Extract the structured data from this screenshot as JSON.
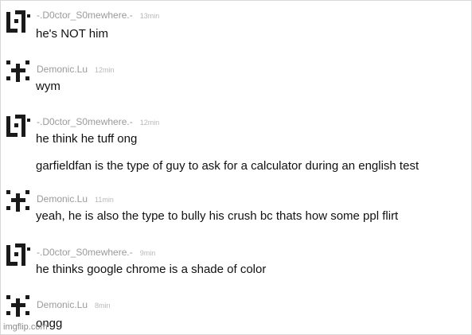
{
  "messages": [
    {
      "user": "-.D0ctor_S0mewhere.-",
      "time": "13min",
      "avatar_icon": "qr-pattern-icon",
      "lines": [
        "he's NOT him"
      ]
    },
    {
      "user": "Demonic.Lu",
      "time": "12min",
      "avatar_icon": "cross-pattern-icon",
      "lines": [
        "wym"
      ]
    },
    {
      "user": "-.D0ctor_S0mewhere.-",
      "time": "12min",
      "avatar_icon": "qr-pattern-icon",
      "lines": [
        "he think he tuff ong",
        "garfieldfan is the type of guy to ask for a calculator during an english test"
      ]
    },
    {
      "user": "Demonic.Lu",
      "time": "11min",
      "avatar_icon": "cross-pattern-icon",
      "lines": [
        "yeah, he is also the type to bully his crush bc thats how some ppl flirt"
      ]
    },
    {
      "user": "-.D0ctor_S0mewhere.-",
      "time": "9min",
      "avatar_icon": "qr-pattern-icon",
      "lines": [
        "he thinks google chrome is a shade of color"
      ]
    },
    {
      "user": "Demonic.Lu",
      "time": "8min",
      "avatar_icon": "cross-pattern-icon",
      "lines": [
        "ongg"
      ]
    }
  ],
  "watermark": "imgflip.com",
  "colors": {
    "username": "#9a9a9a",
    "timestamp": "#b8b8b8",
    "message_text": "#111111",
    "avatar": "#1a1a1a",
    "background": "#ffffff"
  }
}
